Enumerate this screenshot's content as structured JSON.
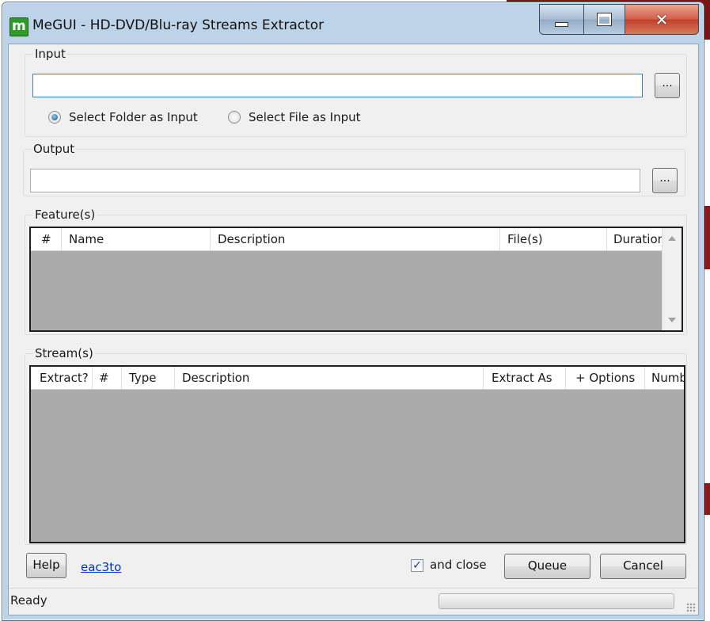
{
  "window": {
    "title": "MeGUI - HD-DVD/Blu-ray Streams Extractor",
    "controls": {
      "minimize": "minimize",
      "maximize": "maximize",
      "close": "✕"
    }
  },
  "input": {
    "group_label": "Input",
    "path_value": "",
    "browse_label": "...",
    "radio_folder": "Select Folder as Input",
    "radio_file": "Select File as Input",
    "selected": "folder"
  },
  "output": {
    "group_label": "Output",
    "path_value": "",
    "browse_label": "..."
  },
  "features": {
    "group_label": "Feature(s)",
    "columns": [
      "#",
      "Name",
      "Description",
      "File(s)",
      "Duration"
    ],
    "rows": []
  },
  "streams": {
    "group_label": "Stream(s)",
    "columns": [
      "Extract?",
      "#",
      "Type",
      "Description",
      "Extract As",
      "+ Options",
      "Numb"
    ],
    "rows": []
  },
  "footer": {
    "help_label": "Help",
    "link_label": "eac3to",
    "and_close_label": "and close",
    "and_close_checked": true,
    "checkmark": "✓",
    "queue_label": "Queue",
    "cancel_label": "Cancel"
  },
  "status": {
    "text": "Ready",
    "progress": 0
  },
  "colors": {
    "accent": "#3c7fb1",
    "list_background": "#ababab",
    "link": "#0033cc"
  }
}
